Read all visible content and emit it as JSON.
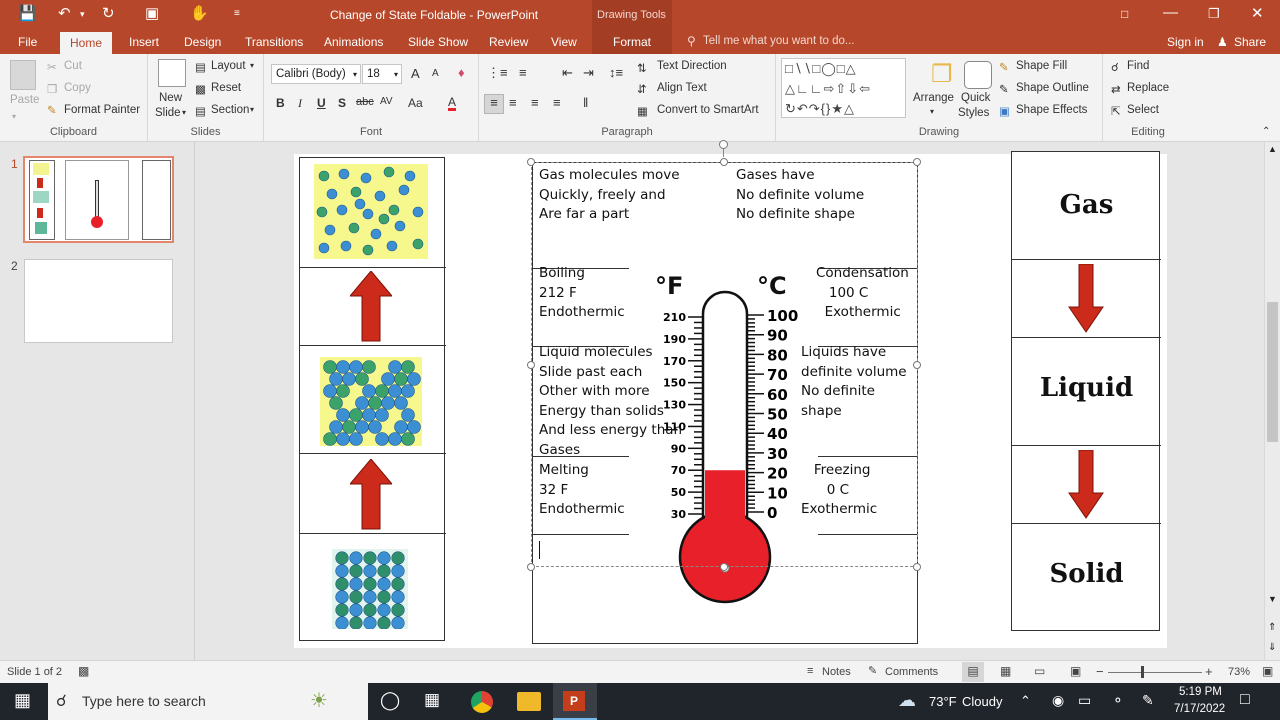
{
  "titlebar": {
    "title": "Change of State Foldable  -  PowerPoint",
    "context_label": "Drawing Tools"
  },
  "tabs": {
    "file": "File",
    "items": [
      "Home",
      "Insert",
      "Design",
      "Transitions",
      "Animations",
      "Slide Show",
      "Review",
      "View"
    ],
    "context_tab": "Format",
    "tell_me": "Tell me what you want to do...",
    "sign_in": "Sign in",
    "share": "Share"
  },
  "ribbon": {
    "clipboard": {
      "paste": "Paste",
      "cut": "Cut",
      "copy": "Copy",
      "format_painter": "Format Painter",
      "label": "Clipboard"
    },
    "slides": {
      "new_slide_1": "New",
      "new_slide_2": "Slide",
      "layout": "Layout",
      "reset": "Reset",
      "section": "Section",
      "label": "Slides"
    },
    "font": {
      "face": "Calibri (Body)",
      "size": "18",
      "bold": "B",
      "italic": "I",
      "underline": "U",
      "shadow": "S",
      "strike": "abc",
      "spacing": "AV",
      "case": "Aa",
      "color": "A",
      "grow": "A",
      "shrink": "A",
      "label": "Font"
    },
    "paragraph": {
      "text_direction": "Text Direction",
      "align_text": "Align Text",
      "convert": "Convert to SmartArt",
      "label": "Paragraph"
    },
    "drawing": {
      "arrange": "Arrange",
      "quick_styles_1": "Quick",
      "quick_styles_2": "Styles",
      "shape_fill": "Shape Fill",
      "shape_outline": "Shape Outline",
      "shape_effects": "Shape Effects",
      "label": "Drawing"
    },
    "editing": {
      "find": "Find",
      "replace": "Replace",
      "select": "Select",
      "label": "Editing"
    }
  },
  "thumbnails": {
    "n1": "1",
    "n2": "2"
  },
  "slide": {
    "gas_text": "Gas molecules move\nQuickly, freely and\nAre far a part",
    "gases_have": "Gases have\nNo definite volume\nNo definite shape",
    "boiling": "Boiling\n212 F\nEndothermic",
    "condensation": "Condensation\n   100 C\n  Exothermic",
    "liquid_text": "Liquid molecules\nSlide past each\nOther with more\nEnergy than solids\nAnd less energy than\nGases",
    "liquids_have": "Liquids have\ndefinite volume\nNo definite\nshape",
    "melting": "Melting\n32 F\nEndothermic",
    "freezing": "   Freezing\n      0 C\nExothermic",
    "thermometer": {
      "f_label": "°F",
      "c_label": "°C",
      "f_ticks": [
        "210",
        "190",
        "170",
        "150",
        "130",
        "110",
        "90",
        "70",
        "50",
        "30"
      ],
      "c_ticks": [
        "100",
        "90",
        "80",
        "70",
        "60",
        "50",
        "40",
        "30",
        "20",
        "10",
        "0"
      ],
      "fill_level_f": 70
    },
    "right_labels": {
      "gas": "Gas",
      "liquid": "Liquid",
      "solid": "Solid"
    }
  },
  "statusbar": {
    "slide_info": "Slide 1 of 2",
    "notes": "Notes",
    "comments": "Comments",
    "zoom": "73%"
  },
  "taskbar": {
    "search": "Type here to search",
    "weather_temp": "73°F",
    "weather_desc": "Cloudy",
    "time": "5:19 PM",
    "date": "7/17/2022"
  },
  "colors": {
    "accent": "#b7472a",
    "thermo_red": "#e8202a",
    "arrow_red": "#cc2a1a"
  }
}
